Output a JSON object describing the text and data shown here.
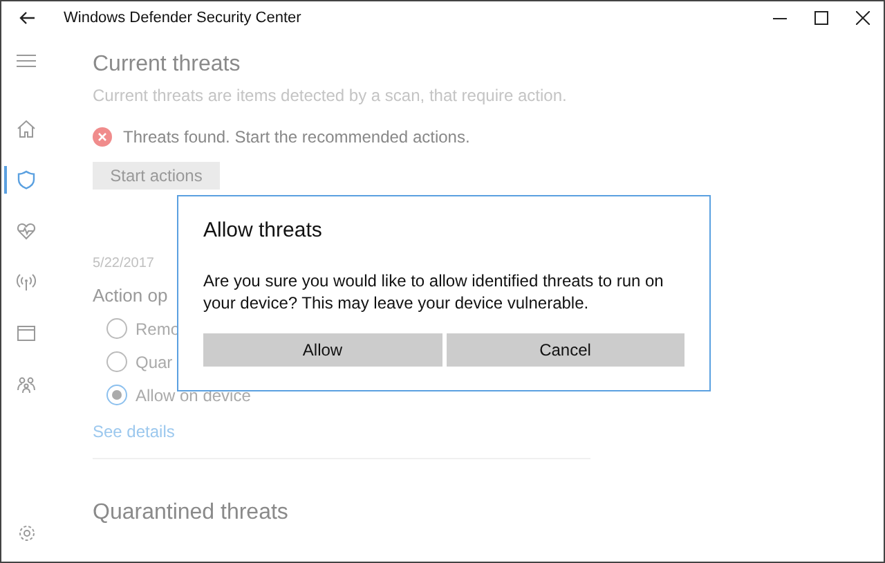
{
  "window": {
    "title": "Windows Defender Security Center"
  },
  "sidebar": {
    "items": [
      {
        "kind": "home",
        "selected": false
      },
      {
        "kind": "shield",
        "selected": true
      },
      {
        "kind": "health",
        "selected": false
      },
      {
        "kind": "network",
        "selected": false
      },
      {
        "kind": "browser",
        "selected": false
      },
      {
        "kind": "family",
        "selected": false
      }
    ]
  },
  "content": {
    "heading": "Current threats",
    "description": "Current threats are items detected by a scan, that require action.",
    "alert": "Threats found. Start the recommended actions.",
    "start_button": "Start actions",
    "threat": {
      "date": "5/22/2017",
      "options_label": "Action op",
      "options": [
        {
          "label": "Remo",
          "selected": false
        },
        {
          "label": "Quar",
          "selected": false
        },
        {
          "label": "Allow on device",
          "selected": true
        }
      ],
      "link": "See details"
    },
    "section_heading": "Quarantined threats"
  },
  "dialog": {
    "title": "Allow threats",
    "message": "Are you sure you would like to allow identified threats to run on your device? This may leave your device vulnerable.",
    "buttons": [
      {
        "label": "Allow"
      },
      {
        "label": "Cancel"
      }
    ]
  }
}
